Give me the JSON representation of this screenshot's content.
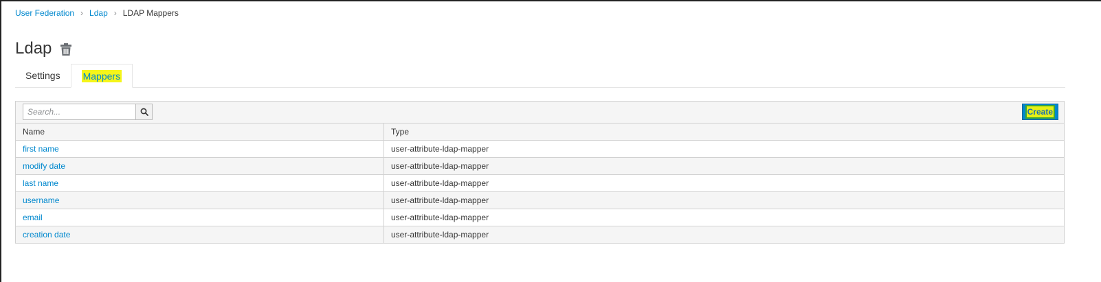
{
  "breadcrumb": {
    "items": [
      "User Federation",
      "Ldap"
    ],
    "current": "LDAP Mappers"
  },
  "page": {
    "title": "Ldap"
  },
  "tabs": [
    {
      "label": "Settings",
      "active": false
    },
    {
      "label": "Mappers",
      "active": true
    }
  ],
  "toolbar": {
    "search_placeholder": "Search...",
    "create_label": "Create"
  },
  "table": {
    "columns": [
      "Name",
      "Type"
    ],
    "rows": [
      {
        "name": "first name",
        "type": "user-attribute-ldap-mapper"
      },
      {
        "name": "modify date",
        "type": "user-attribute-ldap-mapper"
      },
      {
        "name": "last name",
        "type": "user-attribute-ldap-mapper"
      },
      {
        "name": "username",
        "type": "user-attribute-ldap-mapper"
      },
      {
        "name": "email",
        "type": "user-attribute-ldap-mapper"
      },
      {
        "name": "creation date",
        "type": "user-attribute-ldap-mapper"
      }
    ]
  },
  "icons": {
    "delete": "trash-icon",
    "search": "search-icon"
  },
  "colors": {
    "link": "#0088ce",
    "highlight": "#f5f51a",
    "primary_button": "#0088ce"
  }
}
